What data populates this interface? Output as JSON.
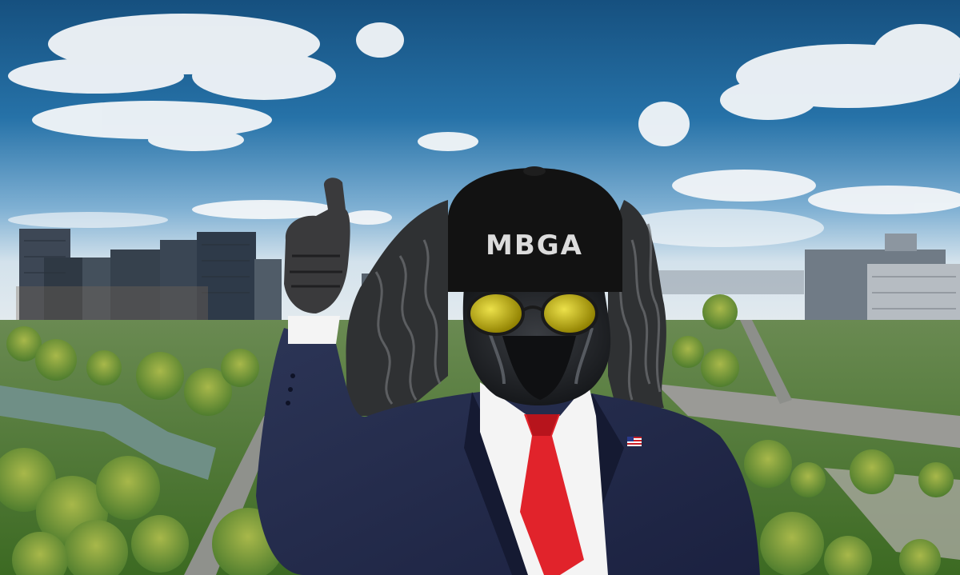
{
  "cap": {
    "text": "MBGA"
  },
  "colors": {
    "sky_top": "#1a5c94",
    "sky_bottom": "#cfe0ee",
    "suit": "#232a4a",
    "tie": "#e1232b",
    "shirt": "#f4f4f4",
    "cap": "#121212",
    "lenses": "#c9b800",
    "foliage": "#4f7d2e"
  },
  "icons": {
    "lapel_pin": "us-flag-pin-icon"
  }
}
